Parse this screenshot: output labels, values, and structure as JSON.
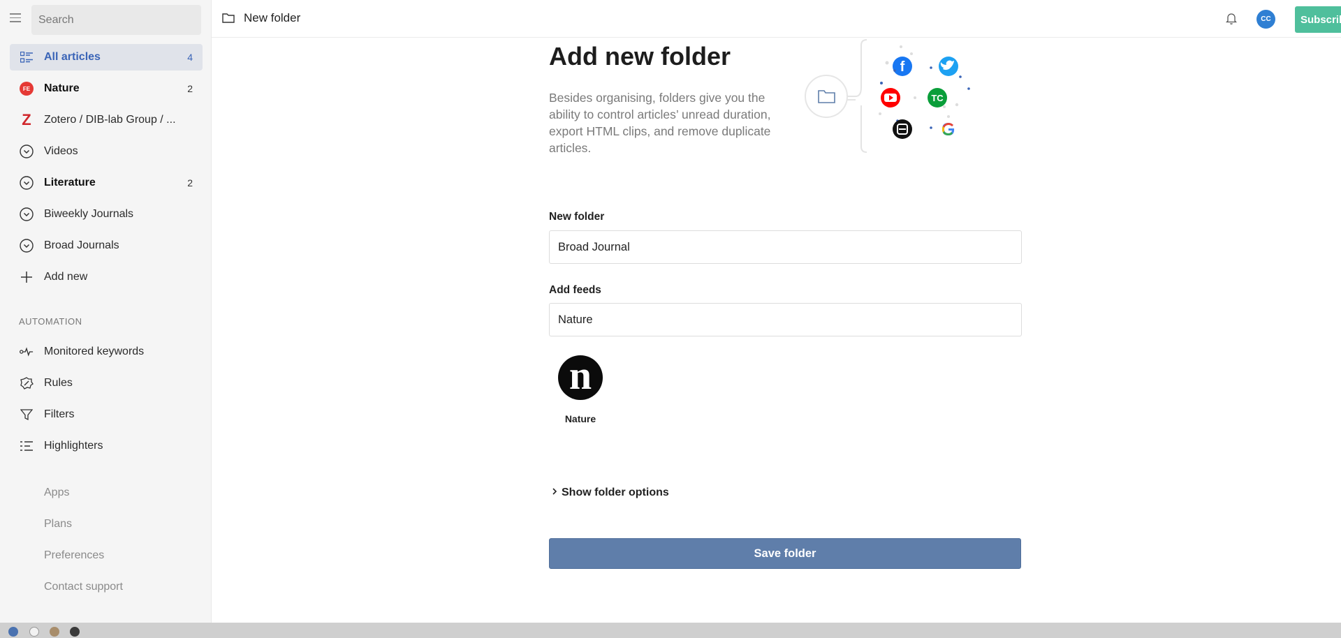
{
  "sidebar": {
    "search_placeholder": "Search",
    "items": [
      {
        "label": "All articles",
        "count": "4"
      },
      {
        "label": "Nature",
        "count": "2",
        "badge": "FE"
      },
      {
        "label": "Zotero / DIB-lab Group / ...",
        "badge": "Z"
      },
      {
        "label": "Videos"
      },
      {
        "label": "Literature",
        "count": "2"
      },
      {
        "label": "Biweekly Journals"
      },
      {
        "label": "Broad Journals"
      },
      {
        "label": "Add new"
      }
    ],
    "automation_heading": "AUTOMATION",
    "automation": [
      {
        "label": "Monitored keywords"
      },
      {
        "label": "Rules"
      },
      {
        "label": "Filters"
      },
      {
        "label": "Highlighters"
      }
    ],
    "footer": [
      {
        "label": "Apps"
      },
      {
        "label": "Plans"
      },
      {
        "label": "Preferences"
      },
      {
        "label": "Contact support"
      }
    ]
  },
  "header": {
    "title": "New folder",
    "avatar_initials": "CC",
    "subscribe_label": "Subscribe"
  },
  "main": {
    "title": "Add new folder",
    "description": "Besides organising, folders give you the ability to control articles’ unread duration, export HTML clips, and remove duplicate articles.",
    "new_folder_label": "New folder",
    "new_folder_value": "Broad Journal",
    "add_feeds_label": "Add feeds",
    "add_feeds_value": "Nature",
    "selected_feed": {
      "name": "Nature",
      "logo_letter": "n"
    },
    "options_label": "Show folder options",
    "save_label": "Save folder"
  },
  "colors": {
    "accent": "#3a64b7",
    "save_button": "#5f7eaa",
    "subscribe": "#4fbf9c",
    "avatar": "#2f7fd3"
  }
}
